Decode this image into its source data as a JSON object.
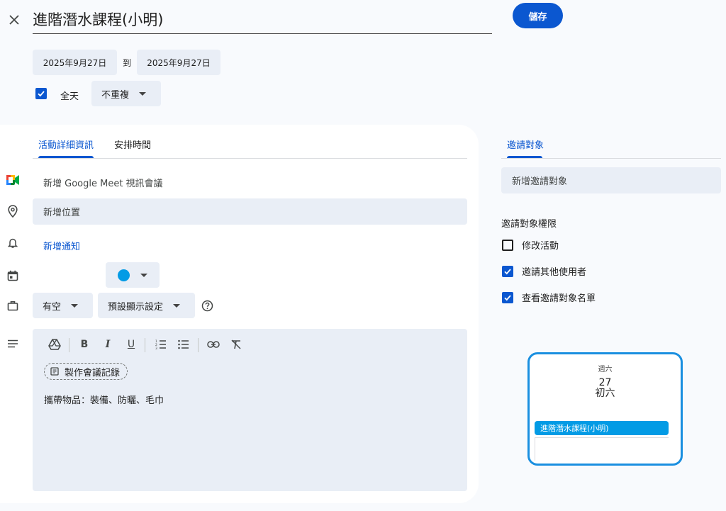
{
  "header": {
    "title": "進階潛水課程(小明)",
    "save_label": "儲存"
  },
  "dates": {
    "start": "2025年9月27日",
    "to_label": "到",
    "end": "2025年9月27日"
  },
  "all_day": {
    "label": "全天",
    "checked": true
  },
  "repeat": {
    "selected": "不重複"
  },
  "tabs": [
    {
      "label": "活動詳細資訊",
      "active": true
    },
    {
      "label": "安排時間",
      "active": false
    }
  ],
  "details": {
    "meet_label": "新增 Google Meet 視訊會議",
    "location_placeholder": "新增位置",
    "add_notification": "新增通知",
    "event_color": "#039be5",
    "availability": "有空",
    "visibility": "預設顯示設定",
    "notes_chip": "製作會議記錄",
    "description": "攜帶物品：裝備、防曬、毛巾"
  },
  "guests": {
    "tab_label": "邀請對象",
    "add_placeholder": "新增邀請對象",
    "permissions_title": "邀請對象權限",
    "permissions": [
      {
        "label": "修改活動",
        "checked": false
      },
      {
        "label": "邀請其他使用者",
        "checked": true
      },
      {
        "label": "查看邀請對象名單",
        "checked": true
      }
    ]
  },
  "preview": {
    "day_of_week": "週六",
    "day": "27",
    "lunar": "初六",
    "event_title": "進階潛水課程(小明)"
  },
  "colors": {
    "accent": "#0b57d0",
    "field_bg": "#e9eef6",
    "page_bg": "#f8fafd"
  }
}
